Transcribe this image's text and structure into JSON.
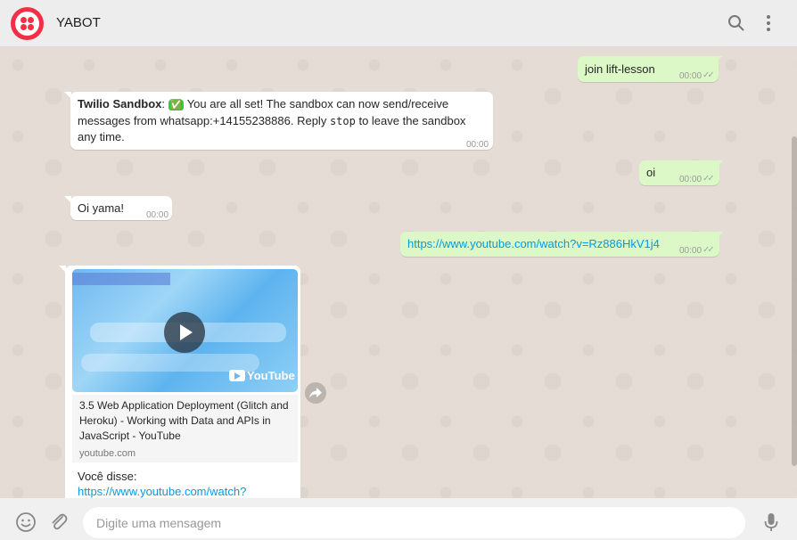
{
  "header": {
    "title": "YABOT",
    "icons": [
      "twilio-logo",
      "search-icon",
      "menu-dots-icon"
    ]
  },
  "messages": [
    {
      "direction": "out",
      "text": "join lift-lesson",
      "time": "00:00"
    },
    {
      "direction": "in",
      "sender": "Twilio Sandbox",
      "emoji": "✅",
      "text_before": " You are all set! The sandbox can now send/receive messages from whatsapp:+14155238886. Reply ",
      "code": "stop",
      "text_after": " to leave the sandbox any time.",
      "time": "00:00"
    },
    {
      "direction": "out",
      "text": "oi",
      "time": "00:00"
    },
    {
      "direction": "in",
      "text": "Oi yama!",
      "time": "00:00"
    },
    {
      "direction": "out",
      "text": "https://www.youtube.com/watch?v=Rz886HkV1j4",
      "time": "00:00"
    }
  ],
  "link_preview": {
    "title": "3.5 Web Application Deployment (Glitch and Heroku) - Working with Data and APIs in JavaScript - YouTube",
    "domain": "youtube.com",
    "brand": "YouTube",
    "said_label": "Você disse:",
    "said_link": "https://www.youtube.com/watch?"
  },
  "footer": {
    "placeholder": "Digite uma mensagem",
    "icons": [
      "emoji-icon",
      "attach-icon",
      "mic-icon"
    ]
  },
  "colors": {
    "outgoing": "#dcf8c6",
    "incoming": "#ffffff",
    "link": "#039be5",
    "brand": "#f22f46"
  }
}
